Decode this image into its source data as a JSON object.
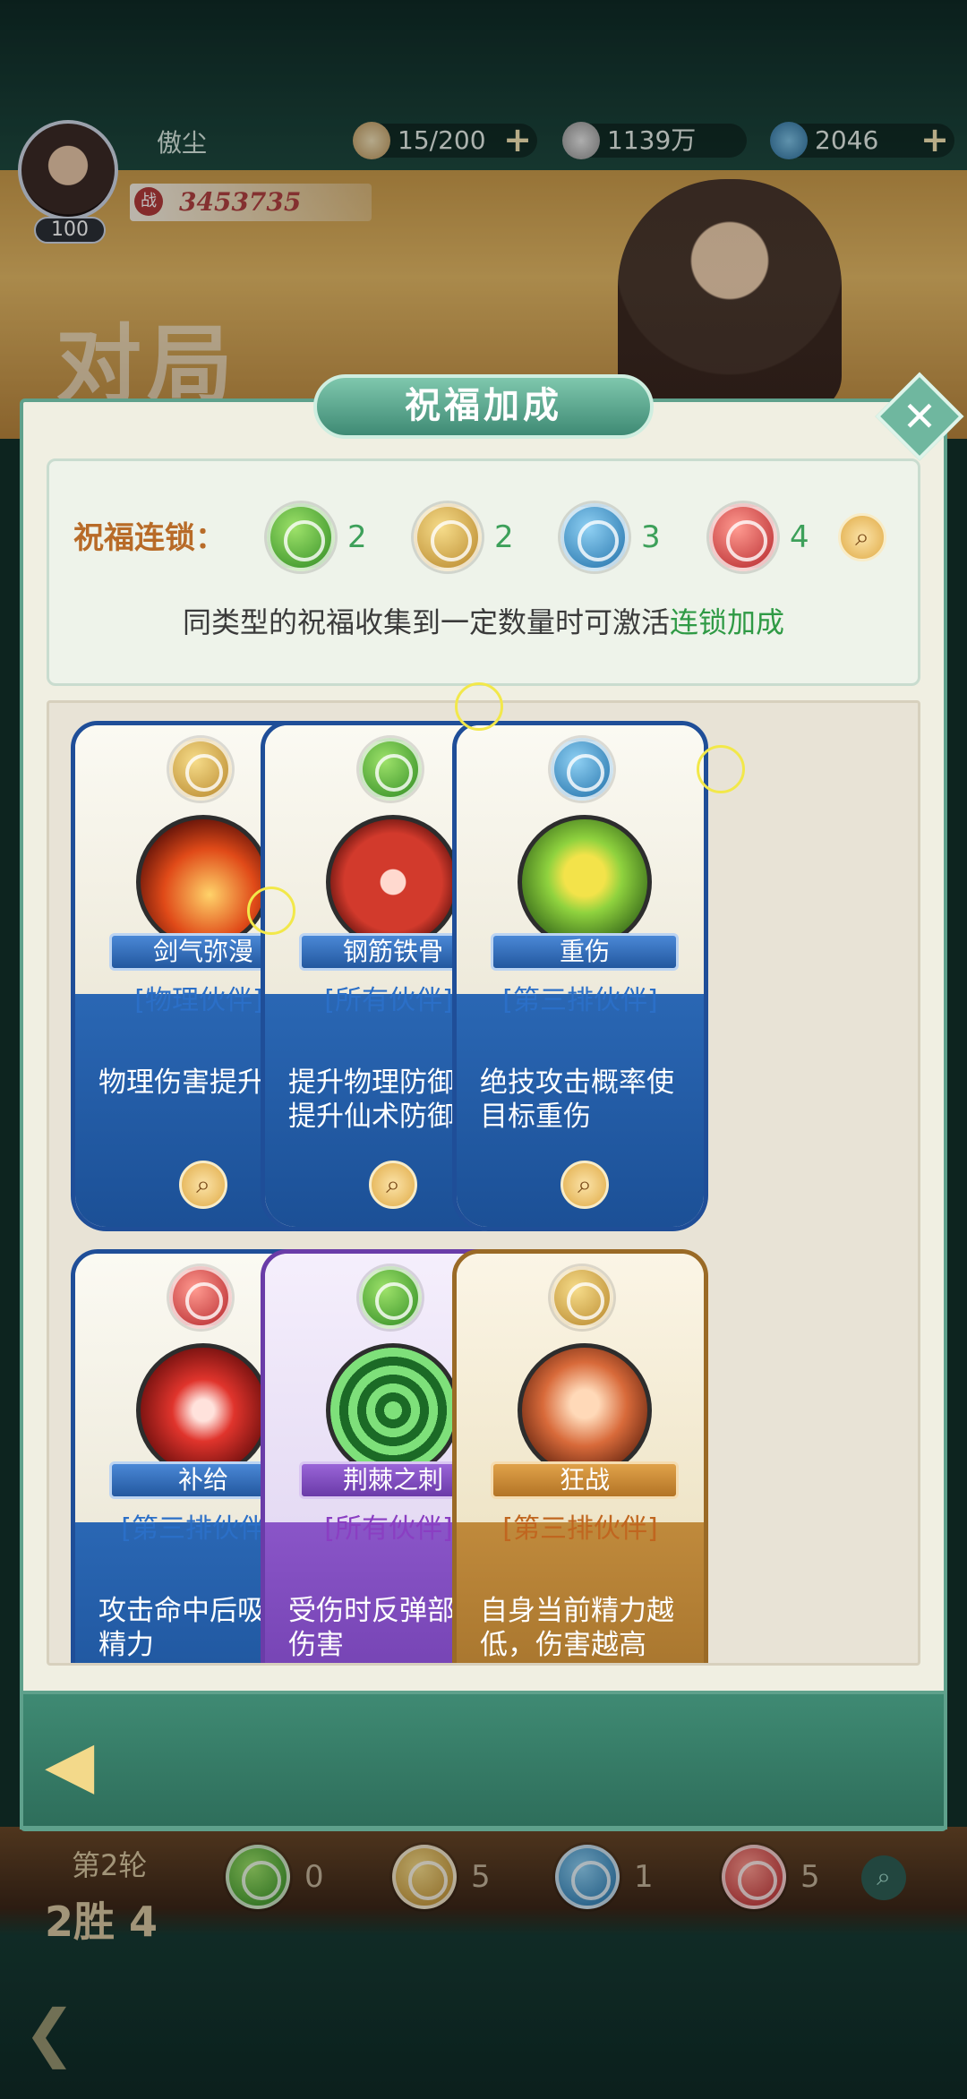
{
  "player": {
    "name": "傲尘",
    "level": "100",
    "power_tag": "战",
    "power": "3453735"
  },
  "resources": [
    {
      "icon": "bun-icon",
      "value": "15/200",
      "has_plus": true
    },
    {
      "icon": "coin-icon",
      "value": "1139万",
      "has_plus": false
    },
    {
      "icon": "jade-icon",
      "value": "2046",
      "has_plus": true
    }
  ],
  "scene_title": "对局",
  "modal": {
    "title": "祝福加成",
    "close": "✕",
    "chain_label": "祝福连锁：",
    "chains": [
      {
        "color": "green",
        "count": "2"
      },
      {
        "color": "gold",
        "count": "2"
      },
      {
        "color": "blue",
        "count": "3"
      },
      {
        "color": "red",
        "count": "4"
      }
    ],
    "desc_main": "同类型的祝福收集到一定数量时可激活",
    "desc_highlight": "连锁加成",
    "cards": [
      {
        "orb": "gold",
        "name": "剑气弥漫",
        "target": "[物理伙伴]",
        "desc": "物理伤害提升",
        "style": "blue"
      },
      {
        "orb": "green",
        "name": "钢筋铁骨",
        "target": "[所有伙伴]",
        "desc": "提升物理防御，提升仙术防御",
        "style": "blue"
      },
      {
        "orb": "blue",
        "name": "重伤",
        "target": "[第三排伙伴]",
        "desc": "绝技攻击概率使目标重伤",
        "style": "blue"
      },
      {
        "orb": "red",
        "name": "补给",
        "target": "[第三排伙伴]",
        "desc": "攻击命中后吸取精力",
        "style": "blue"
      },
      {
        "orb": "green",
        "name": "荆棘之刺",
        "target": "[所有伙伴]",
        "desc": "受伤时反弹部分伤害",
        "style": "purple"
      },
      {
        "orb": "gold",
        "name": "狂战",
        "target": "[第三排伙伴]",
        "desc": "自身当前精力越低，伤害越高",
        "style": "gold"
      }
    ],
    "back": "◀"
  },
  "bottom": {
    "round": "第2轮",
    "result": "2胜 4",
    "chains": [
      {
        "color": "green",
        "count": "0"
      },
      {
        "color": "gold",
        "count": "5"
      },
      {
        "color": "blue",
        "count": "1"
      },
      {
        "color": "red",
        "count": "5"
      }
    ]
  }
}
